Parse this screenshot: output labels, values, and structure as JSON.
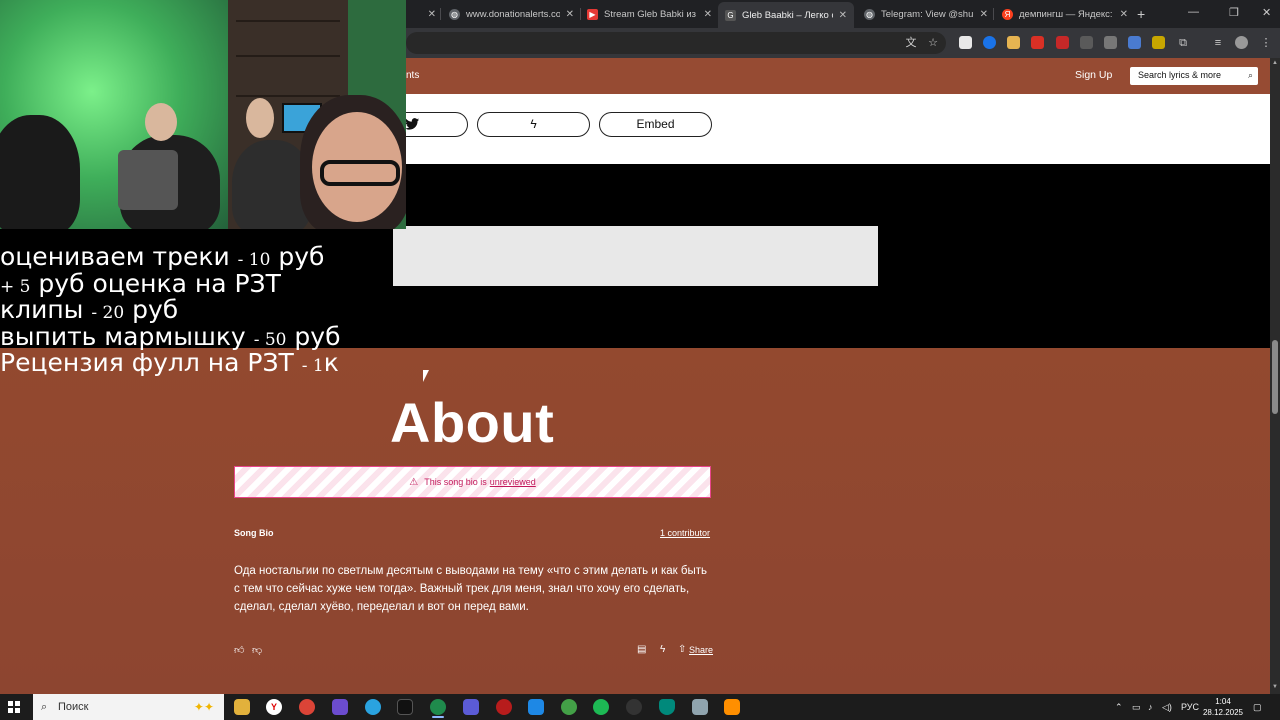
{
  "browser": {
    "tabs": [
      {
        "label": "",
        "favicon": "partial-tab-icon",
        "color": "#202124"
      },
      {
        "label": "www.donationalerts.com",
        "favicon": "globe-icon",
        "color": "#5f6368"
      },
      {
        "label": "Stream Gleb Babki из Мо",
        "favicon": "stream-icon",
        "color": "#e53935"
      },
      {
        "label": "Gleb Baabki – Легко скуч",
        "favicon": "genius-icon",
        "color": "#2a2a2a"
      },
      {
        "label": "Telegram: View @shurab",
        "favicon": "globe-icon",
        "color": "#5f6368"
      },
      {
        "label": "демпингш — Яндекс: на",
        "favicon": "yandex-icon",
        "color": "#fc3f1d"
      }
    ],
    "new_tab_symbol": "+",
    "tab_close_symbol": "✕"
  },
  "genius": {
    "nav_tail": "nts",
    "sign_up": "Sign Up",
    "search_placeholder": "Search lyrics & more",
    "share_buttons": {
      "twitter_icon": "twitter-icon",
      "genius_icon": "lightning-icon",
      "embed_label": "Embed"
    },
    "about": {
      "title": "About",
      "warning_text": "This song bio is",
      "warning_link": "unreviewed",
      "song_bio_label": "Song Bio",
      "contributors": "1 contributor",
      "bio_text": "Ода ностальгии по светлым десятым с выводами на тему «что с этим делать и как быть с тем что сейчас хуже чем тогда». Важный трек для меня, знал что хочу его сделать, сделал, сделал хуёво, переделал и вот он перед вами.",
      "share_label": "Share"
    },
    "brand_color": "#964b33"
  },
  "overlay": {
    "lines": [
      {
        "text": "оцениваем треки",
        "price": "- 10",
        "unit": "руб"
      },
      {
        "prefix": "+ 5",
        "text": "руб оценка на РЗТ"
      },
      {
        "text": "клипы",
        "price": "- 20",
        "unit": "руб"
      },
      {
        "text": "выпить мармышку",
        "price": "- 50",
        "unit": "руб"
      },
      {
        "text": "Рецензия фулл на РЗТ",
        "price": "- 1",
        "unit": "к"
      }
    ]
  },
  "taskbar": {
    "search_label": "Поиск",
    "language": "РУС",
    "time": "1:04",
    "date": "28.12.2025"
  }
}
